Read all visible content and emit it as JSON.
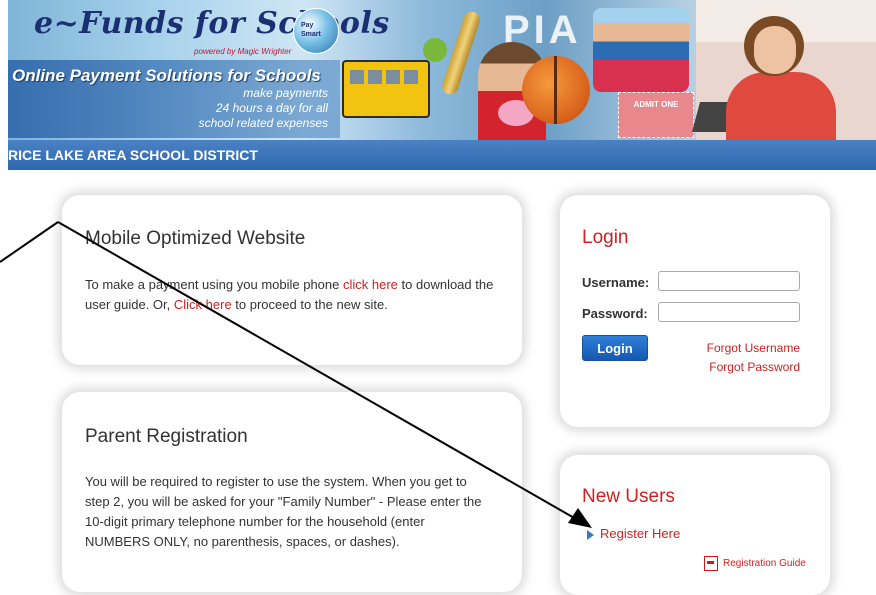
{
  "banner": {
    "logo_title": "e~Funds for Schools",
    "powered_by": "powered by Magic Wrighter",
    "tagline": "Online Payment Solutions for Schools",
    "sub_tagline": [
      "make payments",
      "24 hours a day for all",
      "school related expenses"
    ],
    "pia_text": "PIA",
    "ticket_text": "ADMIT ONE"
  },
  "district": {
    "name": "RICE LAKE AREA SCHOOL DISTRICT"
  },
  "mobile": {
    "title": "Mobile Optimized Website",
    "text_1": "To make a payment using you mobile phone ",
    "link_1": "click here",
    "text_2": " to download the user guide. Or, ",
    "link_2": "Click here",
    "text_3": " to proceed to the new site."
  },
  "parent": {
    "title": "Parent Registration",
    "text": "You will be required to register to use the system. When you get to step 2, you will be asked for your \"Family Number\" - Please enter the 10-digit primary telephone number for the household (enter NUMBERS ONLY, no parenthesis, spaces, or dashes)."
  },
  "login": {
    "title": "Login",
    "username_label": "Username:",
    "username_value": "",
    "password_label": "Password:",
    "password_value": "",
    "button_label": "Login",
    "forgot_username": "Forgot Username",
    "forgot_password": "Forgot Password"
  },
  "new_users": {
    "title": "New Users",
    "register_label": "Register Here",
    "guide_label": "Registration Guide"
  },
  "colors": {
    "accent_red": "#d21f1f",
    "district_bar": "#2e68ad",
    "button_blue": "#1558b0"
  }
}
